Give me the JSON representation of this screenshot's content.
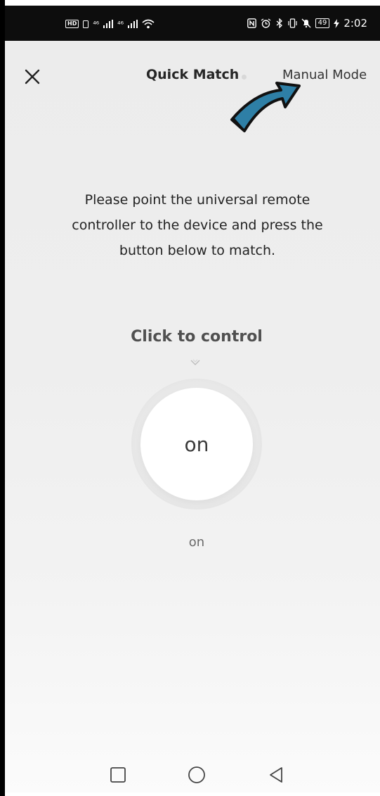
{
  "status_bar": {
    "left_badge": "HD",
    "sim1_label": "⁴⁶",
    "sim2_label": "⁴⁶",
    "battery": "49",
    "time": "2:02"
  },
  "header": {
    "title": "Quick Match",
    "manual_mode_label": "Manual Mode",
    "close_icon": "close-icon"
  },
  "main": {
    "instruction_lines": [
      "Please point the universal remote",
      "controller to the device and press the",
      "button below to match."
    ],
    "click_label": "Click to control",
    "button_label": "on",
    "caption": "on"
  },
  "colors": {
    "annotation_arrow": "#2e7fa6",
    "background": "#eeeeee",
    "status_bar": "#0d0d0d"
  },
  "navigation": {
    "icons": [
      "square-icon",
      "circle-icon",
      "triangle-back-icon"
    ]
  }
}
